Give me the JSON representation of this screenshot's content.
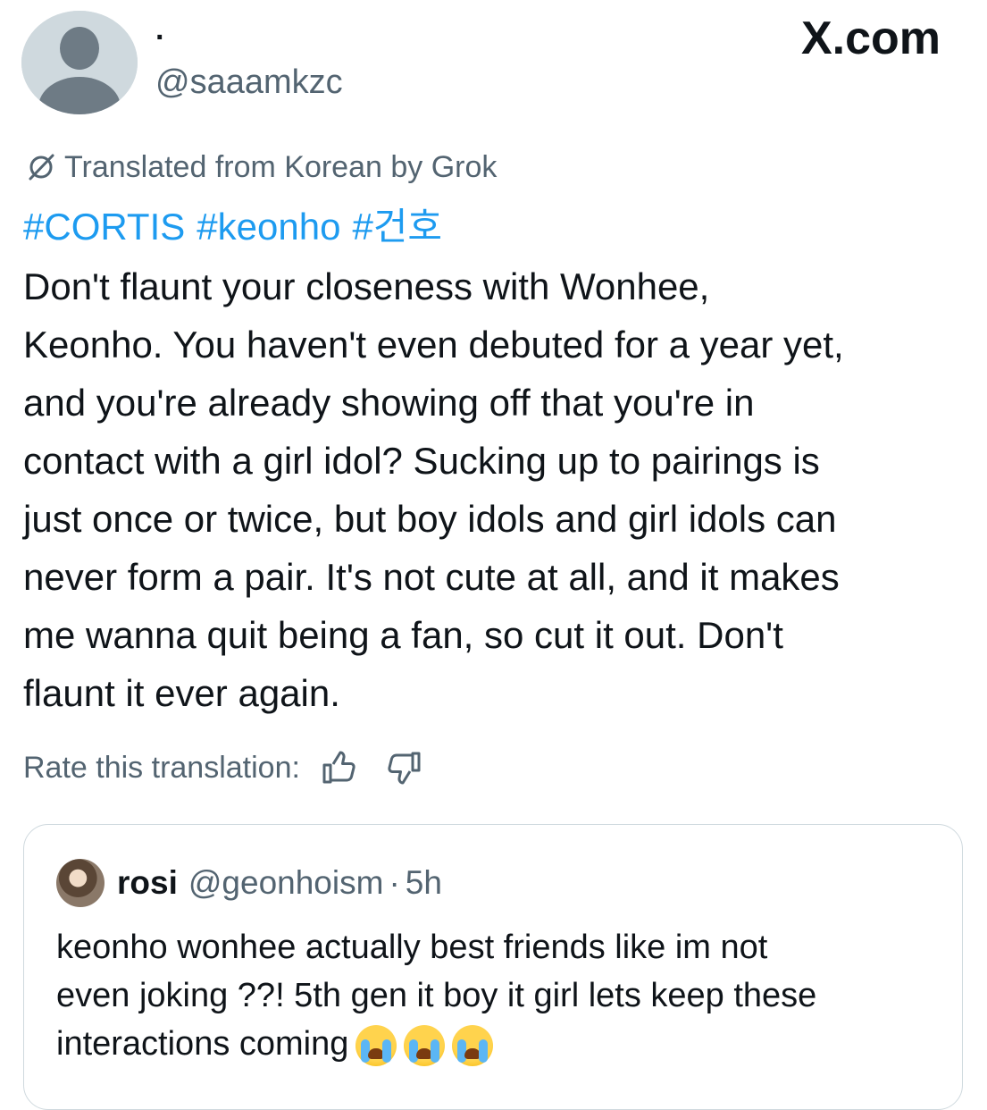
{
  "brand": {
    "text": "X.com"
  },
  "author": {
    "display_name": "·",
    "handle": "@saaamkzc",
    "avatar_icon": "default-avatar-icon"
  },
  "translation": {
    "label": "Translated from Korean by Grok",
    "icon": "grok-icon"
  },
  "hashtags": [
    "#CORTIS",
    "#keonho",
    "#건호"
  ],
  "tweet_text": "Don't flaunt your closeness with Wonhee,\nKeonho. You haven't even debuted for a year yet,\nand you're already showing off that you're in\ncontact with a girl idol? Sucking up to pairings is\njust once or twice, but boy idols and girl idols can\nnever form a pair. It's not cute at all, and it makes\nme wanna quit being a fan, so cut it out. Don't\nflaunt it ever again.",
  "rate": {
    "label": "Rate this translation:",
    "up_icon": "thumbs-up-icon",
    "down_icon": "thumbs-down-icon"
  },
  "quoted": {
    "name": "rosi",
    "handle": "@geonhoism",
    "separator": "·",
    "time": "5h",
    "text": "keonho wonhee actually best friends like im not\neven joking ??! 5th gen it boy it girl lets keep these\ninteractions coming",
    "emoji": [
      "loudly-crying-face",
      "loudly-crying-face",
      "loudly-crying-face"
    ]
  },
  "colors": {
    "link": "#1d9bf0",
    "secondary_text": "#536471",
    "primary_text": "#0f1419",
    "border": "#cfd9de"
  }
}
